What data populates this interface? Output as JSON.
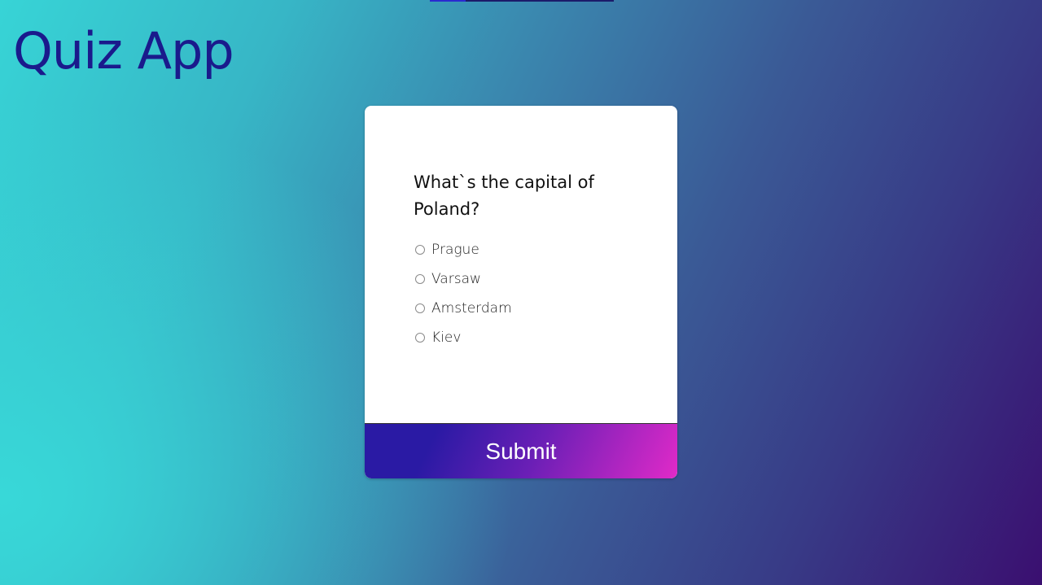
{
  "app": {
    "title": "Quiz App"
  },
  "quiz": {
    "question": "What`s the capital of Poland?",
    "answers": [
      {
        "label": "Prague"
      },
      {
        "label": "Varsaw"
      },
      {
        "label": "Amsterdam"
      },
      {
        "label": "Kiev"
      }
    ],
    "submit_label": "Submit"
  },
  "colors": {
    "title": "#1a1a8c",
    "button_start": "#2a1aa4",
    "button_end": "#e02ac8",
    "card_bg": "#ffffff"
  }
}
